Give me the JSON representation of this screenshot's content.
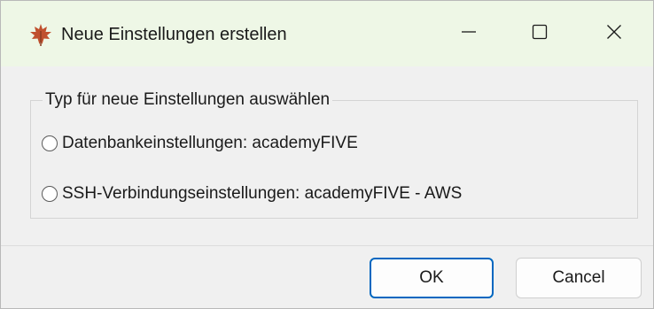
{
  "window": {
    "title": "Neue Einstellungen erstellen",
    "icon": "maple-leaf-icon",
    "controls": {
      "minimize": "minimize-icon",
      "maximize": "maximize-icon",
      "close": "close-icon"
    }
  },
  "group": {
    "legend": "Typ für neue Einstellungen auswählen",
    "options": [
      {
        "label": "Datenbankeinstellungen: academyFIVE",
        "selected": false
      },
      {
        "label": "SSH-Verbindungseinstellungen: academyFIVE - AWS",
        "selected": false
      }
    ]
  },
  "buttons": {
    "ok": "OK",
    "cancel": "Cancel"
  },
  "colors": {
    "titlebar": "#eef7e6",
    "accent": "#0067c0",
    "icon": "#c0502e"
  }
}
